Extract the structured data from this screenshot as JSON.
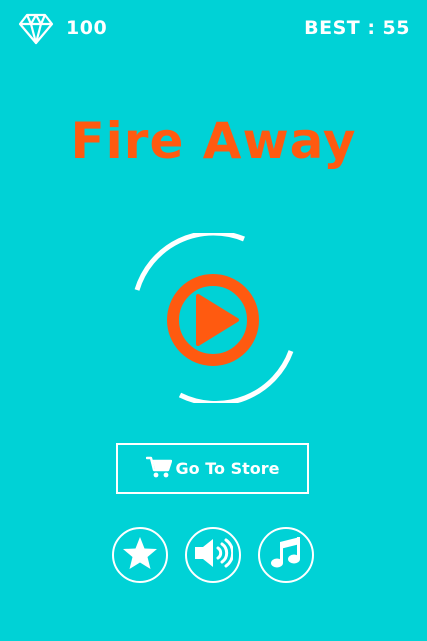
{
  "header": {
    "gems": "100",
    "best": "BEST : 55"
  },
  "title": "Fire Away",
  "menu": {
    "store_label": "Go To Store"
  },
  "icons": {
    "gem": "diamond-icon",
    "play": "play-icon",
    "store": "cart-icon",
    "rate": "star-icon",
    "sound": "speaker-icon",
    "music": "music-note-icon"
  },
  "colors": {
    "background": "#00d2d6",
    "accent": "#ff5a10",
    "foreground": "#ffffff"
  }
}
